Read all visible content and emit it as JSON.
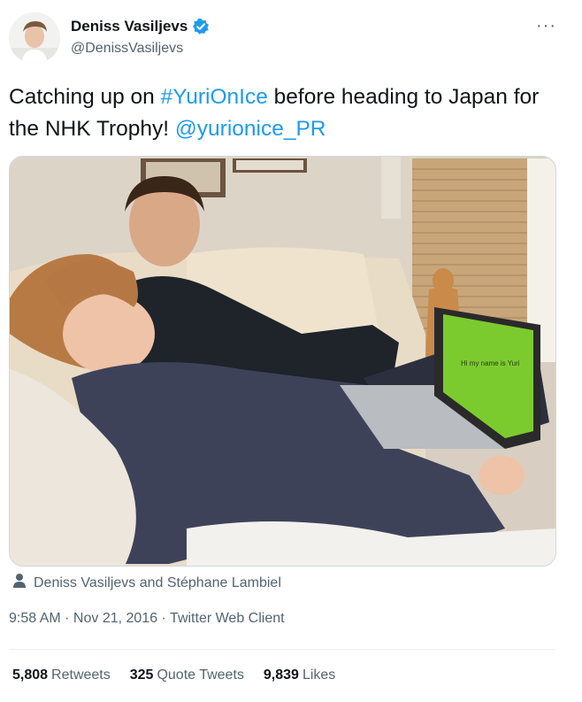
{
  "author": {
    "name": "Deniss Vasiljevs",
    "handle": "@DenissVasiljevs"
  },
  "more_label": "···",
  "tweet": {
    "text_1": "Catching up on ",
    "hashtag": "#YuriOnIce",
    "text_2": " before heading to Japan for the NHK Trophy! ",
    "mention": "@yurionice_PR"
  },
  "media": {
    "laptop_screen_text": "Hi my name is Yuri"
  },
  "tagged_people": "Deniss Vasiljevs and Stéphane Lambiel",
  "meta": {
    "time": "9:58 AM",
    "separator": " · ",
    "date": "Nov 21, 2016",
    "source": "Twitter Web Client"
  },
  "stats": {
    "retweets_count": "5,808",
    "retweets_label": "Retweets",
    "quotes_count": "325",
    "quotes_label": "Quote Tweets",
    "likes_count": "9,839",
    "likes_label": "Likes"
  },
  "colors": {
    "link": "#1d9bf0",
    "secondary_text": "#536471",
    "verified": "#1d9bf0"
  }
}
